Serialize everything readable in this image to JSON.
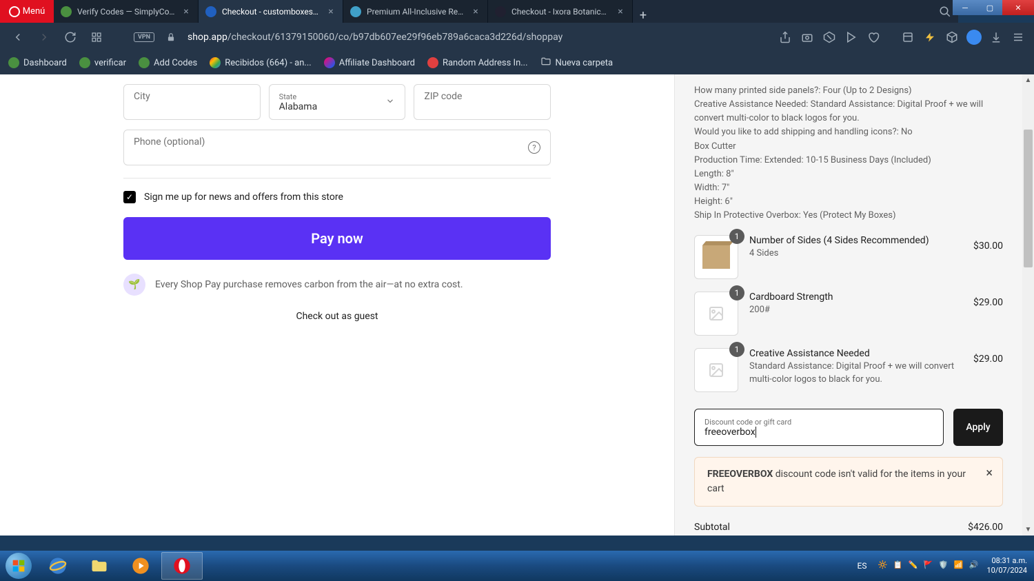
{
  "browser": {
    "menu_label": "Menú",
    "tabs": [
      {
        "title": "Verify Codes — SimplyCod…",
        "favicon": "green"
      },
      {
        "title": "Checkout - customboxes.io",
        "favicon": "blue",
        "active": true
      },
      {
        "title": "Premium All-Inclusive Reso…",
        "favicon": "cyan"
      },
      {
        "title": "Checkout - Ixora Botanical…",
        "favicon": "dark"
      }
    ],
    "url_host": "shop.app",
    "url_path": "/checkout/61379150060/co/b97db607ee29f96eb789a6caca3d226d/shoppay",
    "vpn": "VPN"
  },
  "bookmarks": [
    {
      "label": "Dashboard",
      "icon": "green"
    },
    {
      "label": "verificar",
      "icon": "green"
    },
    {
      "label": "Add Codes",
      "icon": "green"
    },
    {
      "label": "Recibidos (664) - an...",
      "icon": "gmail"
    },
    {
      "label": "Affiliate Dashboard",
      "icon": "multi"
    },
    {
      "label": "Random Address In...",
      "icon": "red"
    },
    {
      "label": "Nueva carpeta",
      "icon": "folder"
    }
  ],
  "form": {
    "city_placeholder": "City",
    "state_label": "State",
    "state_value": "Alabama",
    "zip_placeholder": "ZIP code",
    "phone_placeholder": "Phone (optional)",
    "newsletter_label": "Sign me up for news and offers from this store",
    "pay_button": "Pay now",
    "carbon_text": "Every Shop Pay purchase removes carbon from the air—at no extra cost.",
    "guest_link": "Check out as guest"
  },
  "summary": {
    "specs": [
      "How many printed side panels?: Four (Up to 2 Designs)",
      "Creative Assistance Needed: Standard Assistance: Digital Proof + we will convert multi-color to black logos for you.",
      "Would you like to add shipping and handling icons?: No",
      "Box Cutter",
      "Production Time: Extended: 10-15 Business Days (Included)",
      "Length: 8\"",
      "Width: 7\"",
      "Height: 6\"",
      "Ship In Protective Overbox: Yes (Protect My Boxes)"
    ],
    "items": [
      {
        "qty": "1",
        "title": "Number of Sides (4 Sides Recommended)",
        "sub": "4 Sides",
        "price": "$30.00",
        "thumb": "box"
      },
      {
        "qty": "1",
        "title": "Cardboard Strength",
        "sub": "200#",
        "price": "$29.00",
        "thumb": "ph"
      },
      {
        "qty": "1",
        "title": "Creative Assistance Needed",
        "sub": "Standard Assistance: Digital Proof + we will convert multi-color logos to black for you.",
        "price": "$29.00",
        "thumb": "ph"
      }
    ],
    "discount_label": "Discount code or gift card",
    "discount_value": "freeoverbox",
    "apply_label": "Apply",
    "error_code": "FREEOVERBOX",
    "error_rest": " discount code isn't valid for the items in your cart",
    "subtotal_label": "Subtotal",
    "subtotal_value": "$426.00"
  },
  "taskbar": {
    "lang": "ES",
    "time": "08:31 a.m.",
    "date": "10/07/2024"
  }
}
